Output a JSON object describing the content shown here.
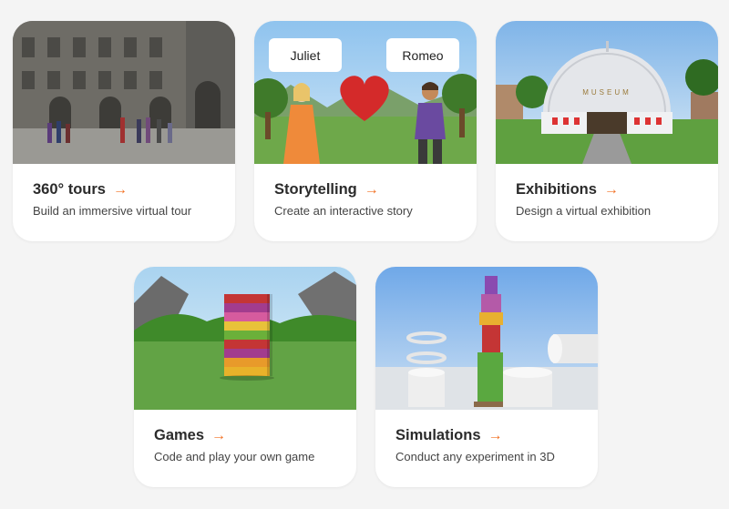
{
  "cards": [
    {
      "title": "360° tours",
      "description": "Build an immersive virtual tour"
    },
    {
      "title": "Storytelling",
      "description": "Create an interactive story",
      "bubbles": [
        "Juliet",
        "Romeo"
      ]
    },
    {
      "title": "Exhibitions",
      "description": "Design a virtual exhibition",
      "sign": "MUSEUM"
    },
    {
      "title": "Games",
      "description": "Code and play your own game"
    },
    {
      "title": "Simulations",
      "description": "Conduct any experiment in 3D"
    }
  ],
  "arrow_glyph": "→",
  "colors": {
    "accent": "#f26f21",
    "background": "#f4f4f4"
  }
}
